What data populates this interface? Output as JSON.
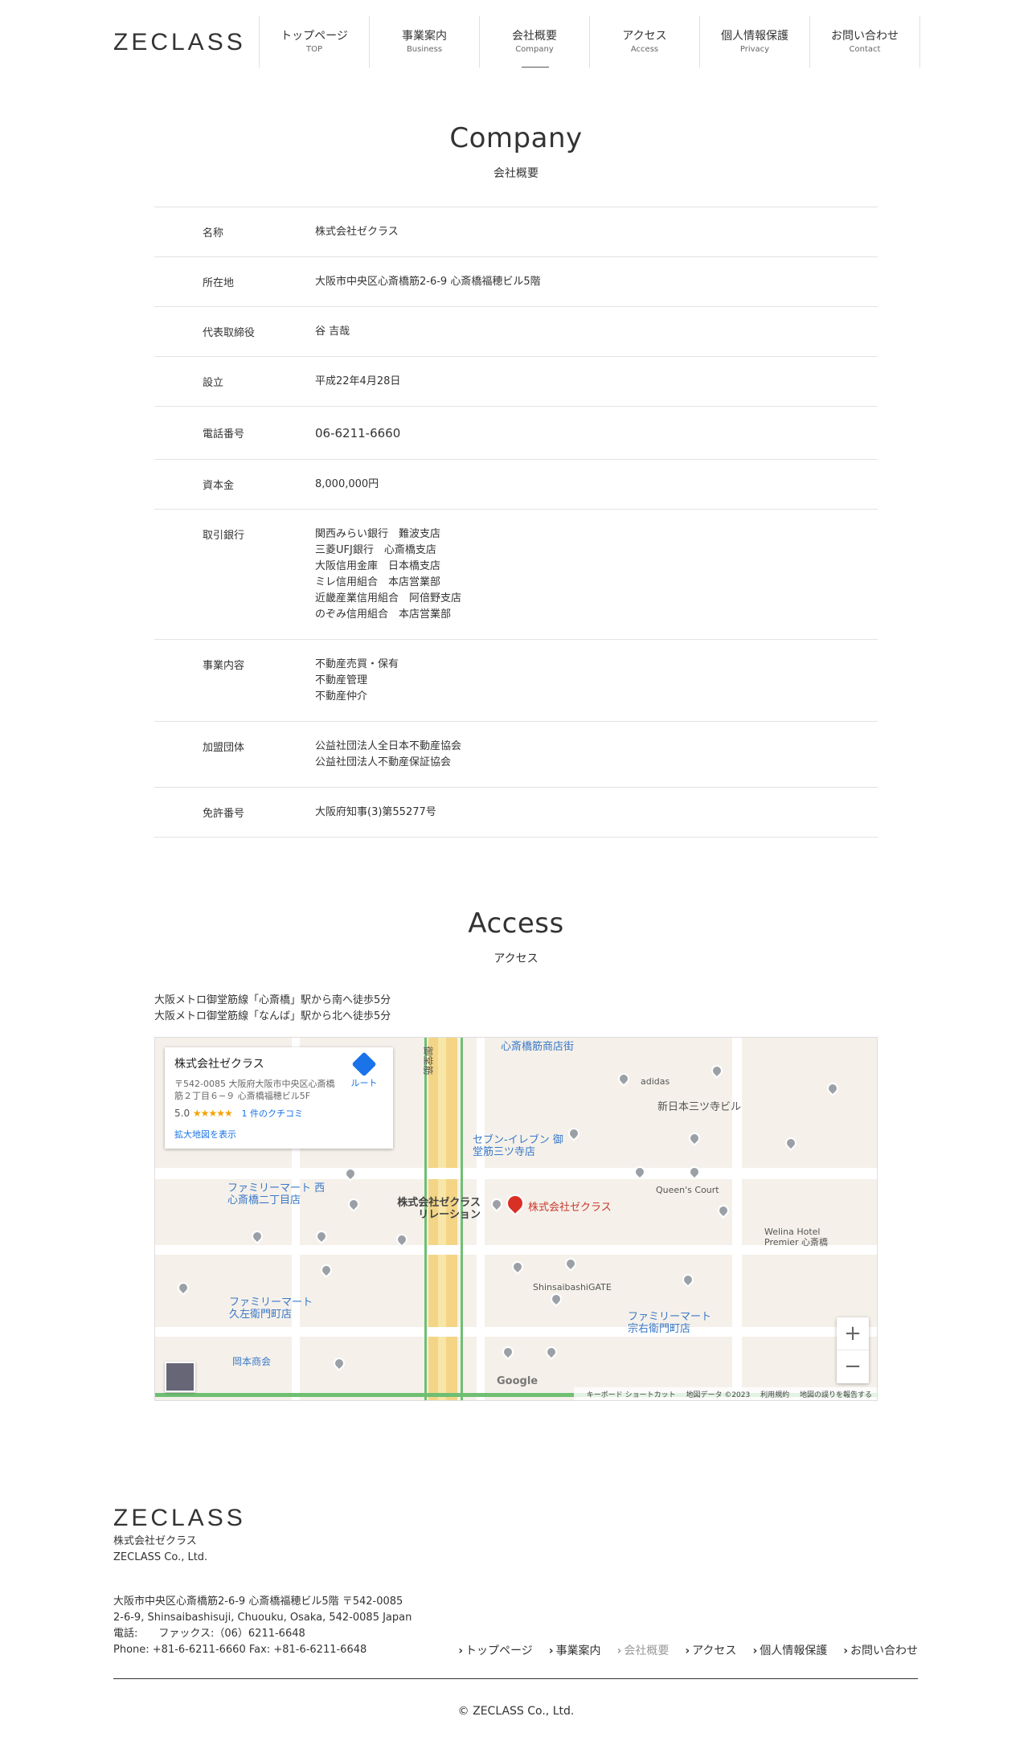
{
  "brand": {
    "logo": "ZECLASS"
  },
  "nav": [
    {
      "ja": "トップページ",
      "en": "TOP"
    },
    {
      "ja": "事業案内",
      "en": "Business"
    },
    {
      "ja": "会社概要",
      "en": "Company"
    },
    {
      "ja": "アクセス",
      "en": "Access"
    },
    {
      "ja": "個人情報保護",
      "en": "Privacy"
    },
    {
      "ja": "お問い合わせ",
      "en": "Contact"
    }
  ],
  "company": {
    "title": "Company",
    "subtitle": "会社概要",
    "rows": [
      {
        "key": "名称",
        "value": [
          "株式会社ゼクラス"
        ]
      },
      {
        "key": "所在地",
        "value": [
          "大阪市中央区心斎橋筋2-6-9 心斎橋福穂ビル5階"
        ]
      },
      {
        "key": "代表取締役",
        "value": [
          "谷 吉哉"
        ]
      },
      {
        "key": "設立",
        "value": [
          "平成22年4月28日"
        ]
      },
      {
        "key": "電話番号",
        "value": [
          "06-6211-6660"
        ]
      },
      {
        "key": "資本金",
        "value": [
          "8,000,000円"
        ]
      },
      {
        "key": "取引銀行",
        "value": [
          "関西みらい銀行　難波支店",
          "三菱UFJ銀行　心斎橋支店",
          "大阪信用金庫　日本橋支店",
          "ミレ信用組合　本店営業部",
          "近畿産業信用組合　阿倍野支店",
          "のぞみ信用組合　本店営業部"
        ]
      },
      {
        "key": "事業内容",
        "value": [
          "不動産売買・保有",
          "不動産管理",
          "不動産仲介"
        ]
      },
      {
        "key": "加盟団体",
        "value": [
          "公益社団法人全日本不動産協会",
          "公益社団法人不動産保証協会"
        ]
      },
      {
        "key": "免許番号",
        "value": [
          "大阪府知事(3)第55277号"
        ]
      }
    ]
  },
  "access": {
    "title": "Access",
    "subtitle": "アクセス",
    "directions": [
      "大阪メトロ御堂筋線「心斎橋」駅から南へ徒歩5分",
      "大阪メトロ御堂筋線「なんば」駅から北へ徒歩5分"
    ]
  },
  "map": {
    "card": {
      "name": "株式会社ゼクラス",
      "address": "〒542-0085 大阪府大阪市中央区心斎橋筋２丁目６−９ 心斎橋福穂ビル5F",
      "rating": "5.0",
      "stars": "★★★★★",
      "reviews": "1 件のクチコミ",
      "route": "ルート",
      "link": "拡大地図を表示"
    },
    "labels": {
      "pin": "株式会社ゼクラス",
      "relation": "株式会社ゼクラス リレーション",
      "shopping": "心斎橋筋商店街",
      "seven": "セブン-イレブン 御堂筋三ツ寺店",
      "family1": "ファミリーマート 西心斎橋二丁目店",
      "family2": "ファミリーマート 久左衛門町店",
      "family3": "ファミリーマート 宗右衛門町店",
      "midosuji": "御堂筋",
      "queens": "Queen's Court",
      "mitsudera": "新日本三ツ寺ビル",
      "welina": "Welina Hotel Premier 心斎橋",
      "shinsaibashigate": "ShinsaibashiGATE",
      "okamoto": "岡本商会",
      "adidas": "adidas"
    },
    "footer": [
      "キーボード ショートカット",
      "地図データ ©2023",
      "利用規約",
      "地図の誤りを報告する"
    ],
    "google": "Google"
  },
  "footer": {
    "logo": "ZECLASS",
    "company": [
      "株式会社ゼクラス",
      "ZECLASS Co., Ltd."
    ],
    "address": [
      "大阪市中央区心斎橋筋2-6-9 心斎橋福穂ビル5階 〒542-0085",
      "2-6-9, Shinsaibashisuji, Chuouku, Osaka, 542-0085 Japan",
      "電話:　　ファックス:（06）6211-6648",
      "Phone: +81-6-6211-6660 Fax: +81-6-6211-6648"
    ],
    "nav": [
      "トップページ",
      "事業案内",
      "会社概要",
      "アクセス",
      "個人情報保護",
      "お問い合わせ"
    ],
    "copyright": "© ZECLASS Co., Ltd."
  }
}
